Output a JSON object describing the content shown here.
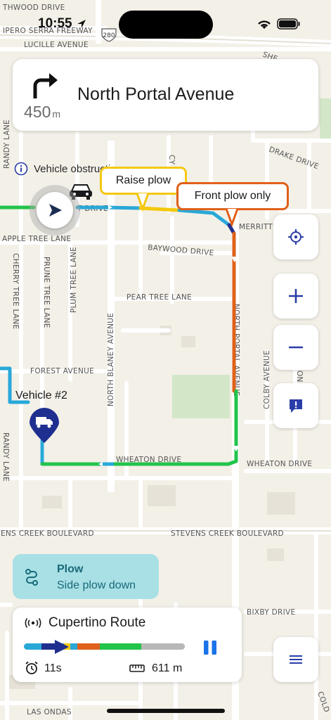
{
  "status_bar": {
    "time": "10:55"
  },
  "navigation": {
    "distance_value": "450",
    "distance_unit": "m",
    "street": "North Portal Avenue"
  },
  "notice": {
    "text": "Vehicle obstruction"
  },
  "callouts": {
    "raise_plow": "Raise plow",
    "front_plow_only": "Front plow only"
  },
  "map": {
    "highway_shield": "280",
    "streets": {
      "hawthwood_drive": "THWOOD DRIVE",
      "junipero_serra": "IPERO SERRA FREEWAY",
      "lucille": "LUCILLE AVENUE",
      "randy_top": "RANDY LANE",
      "randy_bottom": "RANDY LANE",
      "cy": "CY",
      "drake": "DRAKE DRIVE",
      "merritt": "MERRITT D",
      "apple_tree": "APPLE TREE LANE",
      "baywood": "BAYWOOD DRIVE",
      "cherry_tree": "CHERRY TREE LANE",
      "prune_tree": "PRUNE TREE LANE",
      "plum_tree": "PLUM TREE LANE",
      "pear_tree": "PEAR TREE LANE",
      "north_portal": "NORTH PORTAL AVENUE",
      "north_blaney": "NORTH BLANEY AVENUE",
      "forest": "FOREST AVENUE",
      "colby": "COLBY AVENUE",
      "son": "SON",
      "wheaton_left": "WHEATON DRIVE",
      "wheaton_right": "WHEATON DRIVE",
      "stevens_left": "ENS CREEK BOULEVARD",
      "stevens_right": "STEVENS CREEK BOULEVARD",
      "bixby": "BIXBY DRIVE",
      "las_ondas": "LAS ONDAS",
      "she": "SHE",
      "t_drive": "T DRIVE",
      "cold": "COLD"
    }
  },
  "vehicle": {
    "label": "Vehicle #2"
  },
  "plow_status": {
    "title": "Plow",
    "subtitle": "Side plow down"
  },
  "route": {
    "name": "Cupertino Route",
    "eta": "11s",
    "distance": "611 m",
    "progress_segments": [
      {
        "color": "#29a8d8",
        "fraction": 0.11
      },
      {
        "color": "#1f2f8f",
        "fraction": 0.08
      },
      {
        "color": "#29a8d8",
        "fraction": 0.06
      },
      {
        "color": "#f4c80f",
        "fraction": 0.04
      },
      {
        "color": "#29a8d8",
        "fraction": 0.04
      },
      {
        "color": "#e0601a",
        "fraction": 0.14
      },
      {
        "color": "#22c44a",
        "fraction": 0.26
      },
      {
        "color": "#b8b8b8",
        "fraction": 0.27
      }
    ]
  },
  "colors": {
    "accent": "#2b3da8",
    "route_green": "#22c44a",
    "route_blue": "#29a8d8",
    "route_orange": "#e0601a",
    "route_yellow": "#f4c80f"
  },
  "icons": [
    "turn-right-icon",
    "info-icon",
    "car-icon",
    "navigation-arrow-icon",
    "crosshair-icon",
    "plus-icon",
    "minus-icon",
    "report-icon",
    "truck-pin-icon",
    "plow-route-icon",
    "signal-icon",
    "play-marker-icon",
    "pause-icon",
    "alarm-clock-icon",
    "ruler-icon",
    "menu-icon"
  ]
}
